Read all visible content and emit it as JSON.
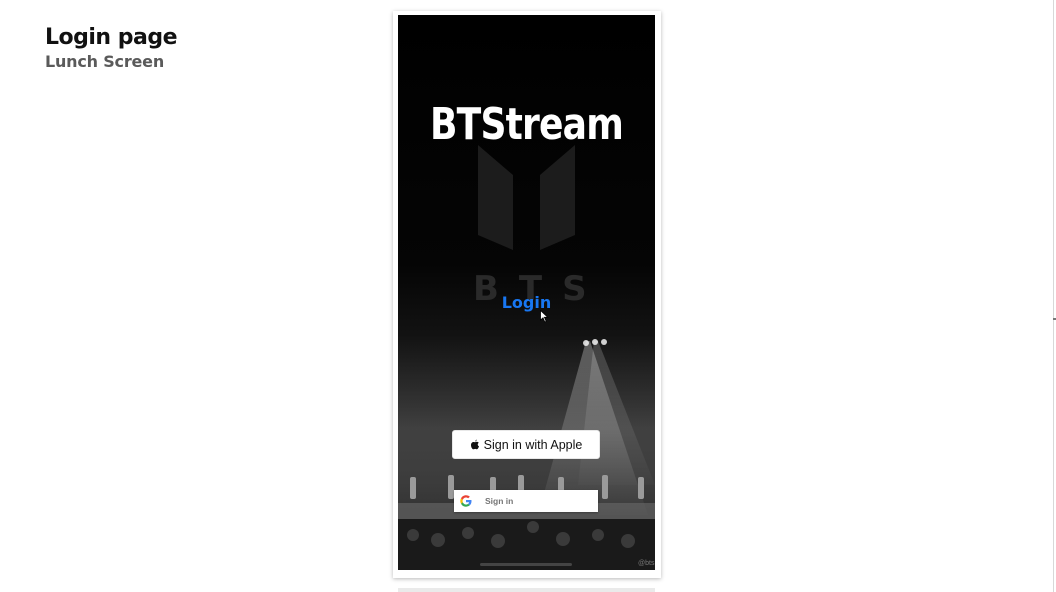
{
  "heading": {
    "title": "Login page",
    "subtitle": "Lunch Screen"
  },
  "app": {
    "brand_title": "BTStream",
    "login_link": "Login",
    "apple_button_label": "Sign in with Apple",
    "google_button_label": "Sign in",
    "watermark": "@bts"
  },
  "colors": {
    "login_link": "#1877f2",
    "screen_background": "#000000",
    "button_background": "#ffffff"
  },
  "icons": [
    "apple-icon",
    "google-icon",
    "cursor-icon"
  ]
}
